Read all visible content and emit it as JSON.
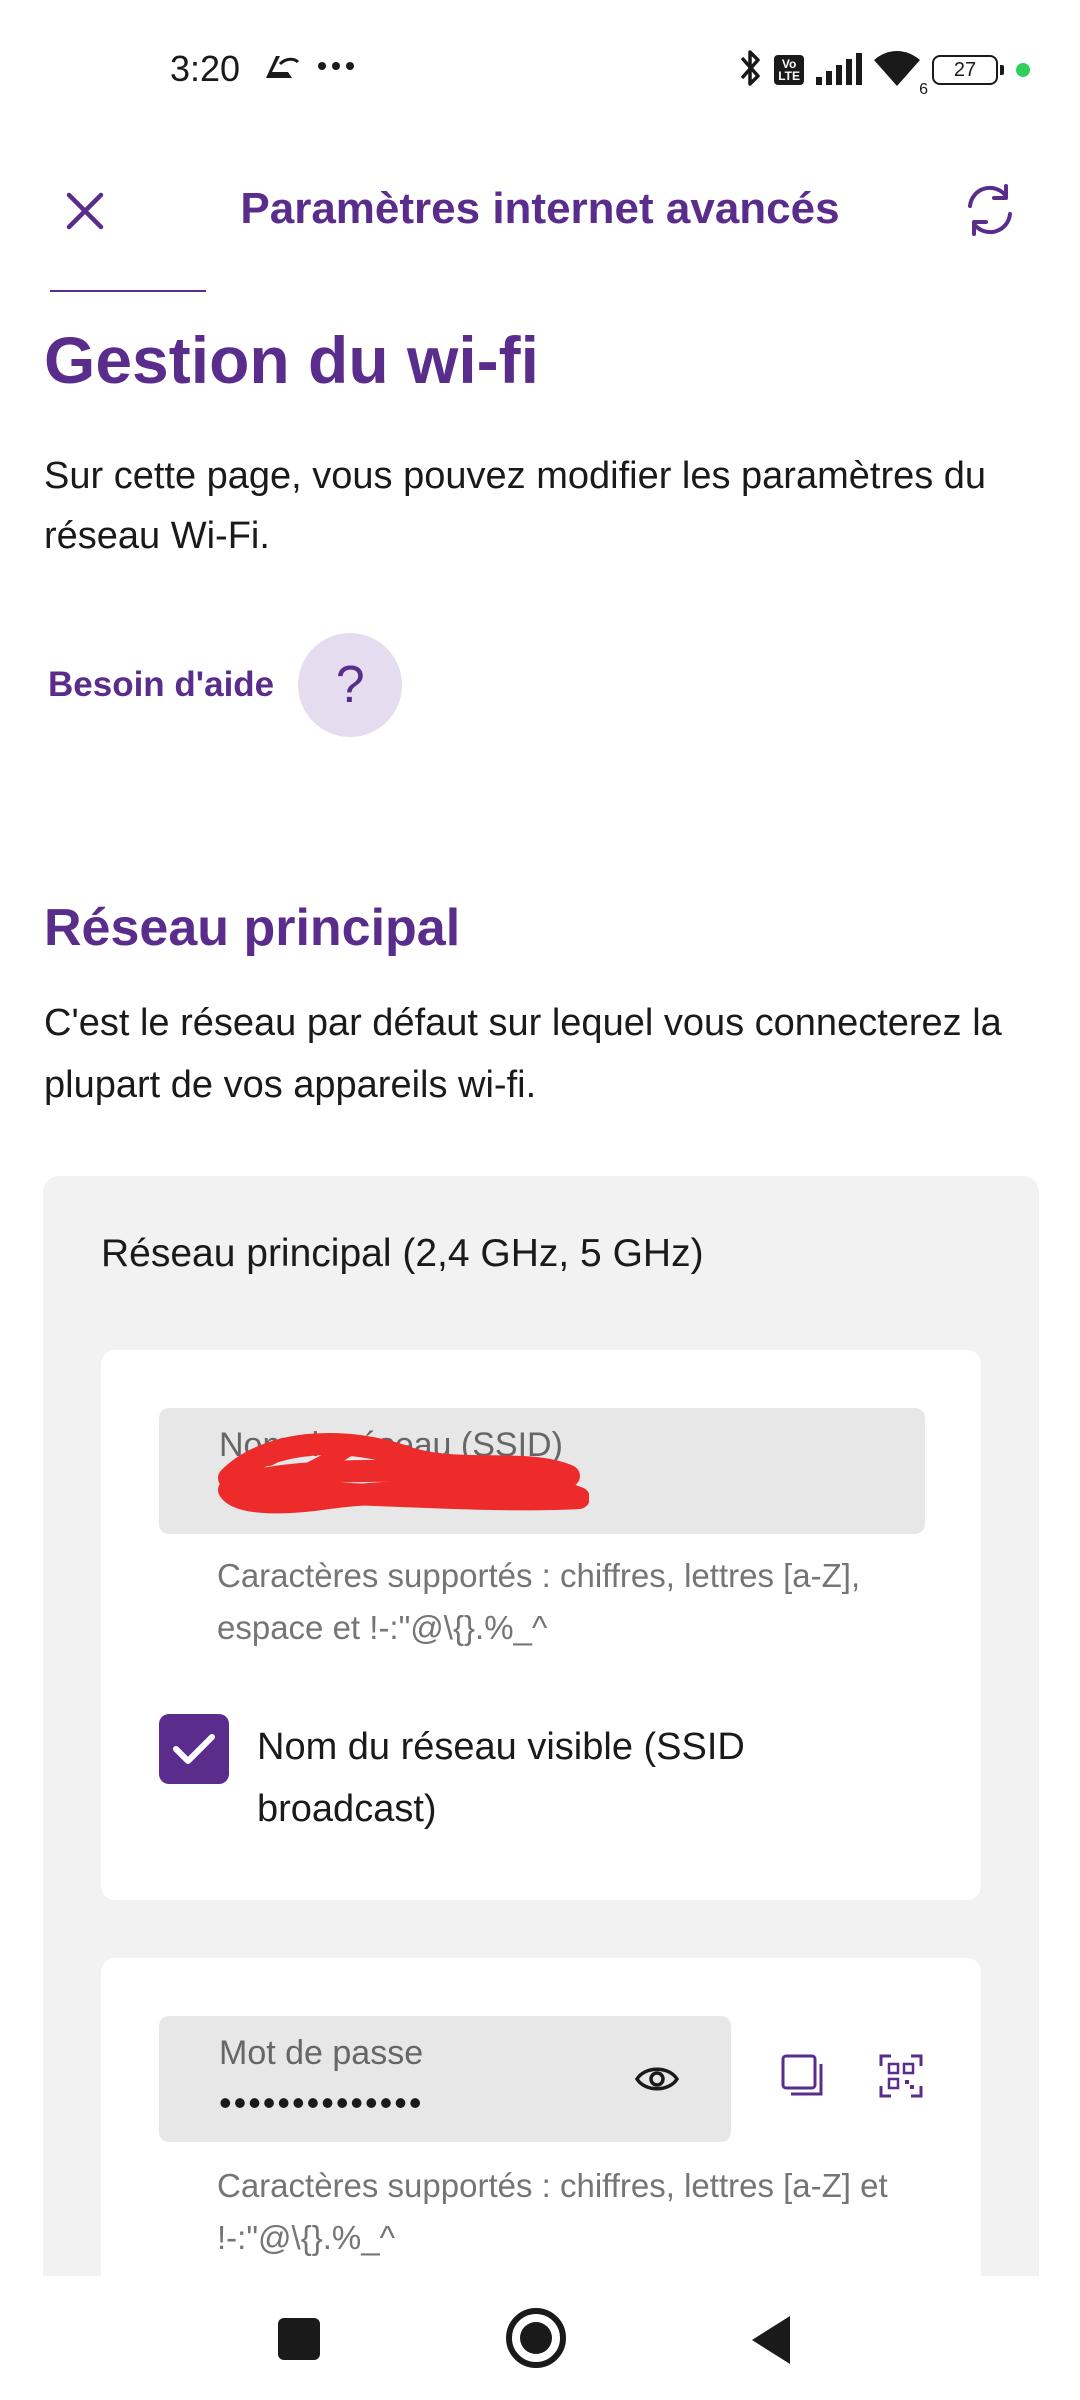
{
  "status_bar": {
    "time": "3:20",
    "left_icons": [
      "signal-app-icon",
      "more-dots-icon"
    ],
    "right_icons": [
      "bluetooth-icon",
      "volte-icon",
      "cell-signal-icon",
      "wifi-icon",
      "battery-icon"
    ],
    "volte_text": "Vo\nLTE",
    "wifi_badge": "6",
    "battery": "27"
  },
  "header": {
    "title": "Paramètres internet avancés",
    "close_icon": "close-icon",
    "refresh_icon": "refresh-icon"
  },
  "page": {
    "title": "Gestion du wi-fi",
    "intro": "Sur cette page, vous pouvez modifier les paramètres du réseau Wi-Fi.",
    "help_label": "Besoin d'aide",
    "help_icon": "?"
  },
  "section": {
    "title": "Réseau principal",
    "description": "C'est le réseau par défaut sur lequel vous connecterez la plupart de vos appareils wi-fi."
  },
  "panel": {
    "title": "Réseau principal (2,4 GHz, 5 GHz)",
    "ssid": {
      "label": "Nom du réseau (SSID)",
      "value": "",
      "hint": "Caractères supportés : chiffres, lettres [a-Z], espace et !-:\"@\\{}.%_^"
    },
    "broadcast": {
      "checked": true,
      "label": "Nom du réseau visible (SSID broadcast)"
    },
    "password": {
      "label": "Mot de passe",
      "value": "••••••••••••••",
      "hint": "Caractères supportés : chiffres, lettres [a-Z] et !-:\"@\\{}.%_^"
    }
  },
  "colors": {
    "brand_purple": "#5a2d8c",
    "help_bg": "#e6dcef",
    "panel_bg": "#f2f2f2",
    "field_bg": "#e7e7e7",
    "redaction": "#ee2b2b"
  }
}
